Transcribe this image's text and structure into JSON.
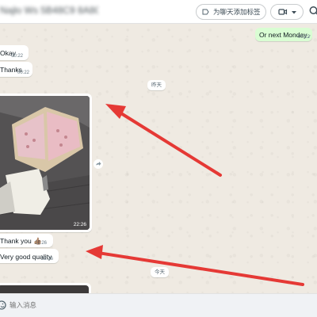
{
  "header": {
    "chat_name": "Najlo Ws 5B48C9 8A8C40 0 D",
    "label_button": "为聊天添加标签"
  },
  "messages": {
    "outgoing_next": {
      "text": "Or next Monday",
      "time": "00:22",
      "ticks": "✓✓"
    },
    "okay": {
      "text": "Okay",
      "time": "00:22"
    },
    "thanks": {
      "text": "Thanks",
      "time": "00:22"
    },
    "date_yesterday": "昨天",
    "photo_time": "22:26",
    "thank_you": {
      "text": "Thank you 👍🏽",
      "time": "22:26"
    },
    "very_good": {
      "text": "Very good quality",
      "time": "22:26"
    },
    "date_today": "今天"
  },
  "composer": {
    "placeholder": "输入消息"
  },
  "colors": {
    "arrow": "#e53935",
    "incoming": "#ffffff",
    "outgoing": "#d9fdd3",
    "chat_bg": "#efeae2"
  },
  "icons": [
    "label-icon",
    "video-camera-icon",
    "chevron-down-icon",
    "search-icon",
    "forward-icon",
    "emoji-icon"
  ]
}
